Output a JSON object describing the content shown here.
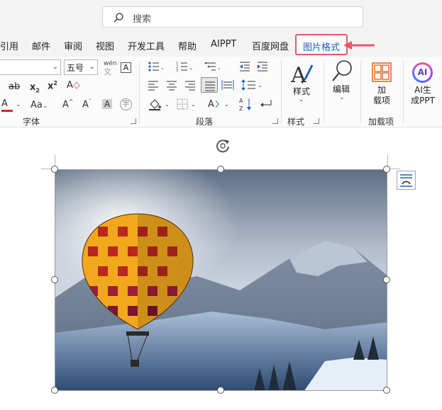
{
  "search": {
    "placeholder": "搜索"
  },
  "menu": {
    "tabs": [
      "引用",
      "邮件",
      "审阅",
      "视图",
      "开发工具",
      "帮助",
      "AIPPT",
      "百度网盘"
    ],
    "active_tab": "图片格式"
  },
  "font_group": {
    "font_size": "五号",
    "phonetic_label": "wén",
    "label": "字体"
  },
  "paragraph_group": {
    "label": "段落"
  },
  "styles_group": {
    "button": "样式",
    "label": "样式"
  },
  "editing": {
    "button": "编辑"
  },
  "addins": {
    "button_line1": "加",
    "button_line2": "载项",
    "label": "加载项"
  },
  "ai": {
    "badge": "AI",
    "line1": "AI生",
    "line2": "成PPT"
  },
  "colors": {
    "accent_red": "#e35a6a",
    "active_tab_text": "#1f5fbf",
    "font_color_bar": "#d62828",
    "addin_orange": "#e26a2c"
  }
}
